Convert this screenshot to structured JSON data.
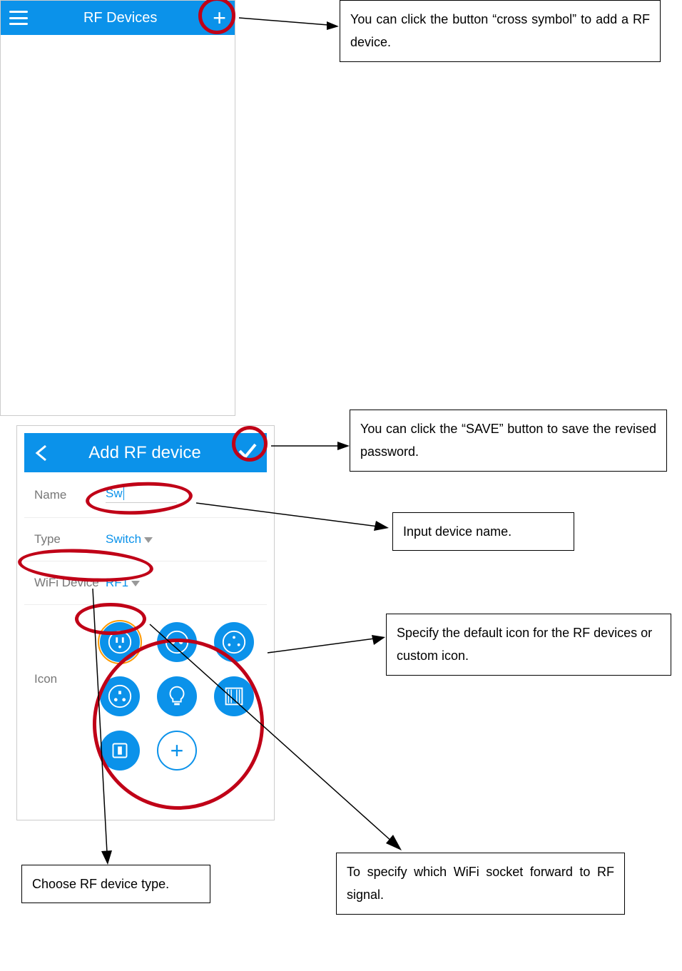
{
  "screen1": {
    "title": "RF Devices"
  },
  "screen2": {
    "title": "Add RF device",
    "fields": {
      "name": {
        "label": "Name",
        "value": "Sw"
      },
      "type": {
        "label": "Type",
        "value": "Switch"
      },
      "wifi": {
        "label": "WiFi Device",
        "value": "RF1"
      },
      "iconLabel": "Icon"
    }
  },
  "callouts": {
    "addBtn": "You can click the button “cross symbol” to add a RF device.",
    "saveBtn": "You can click the “SAVE” button to save the revised password.",
    "nameInput": "Input device name.",
    "iconPick": "Specify the default icon for the RF devices or custom icon.",
    "typePick": "Choose RF device type.",
    "wifiPick": "To specify which WiFi socket forward to RF signal."
  }
}
